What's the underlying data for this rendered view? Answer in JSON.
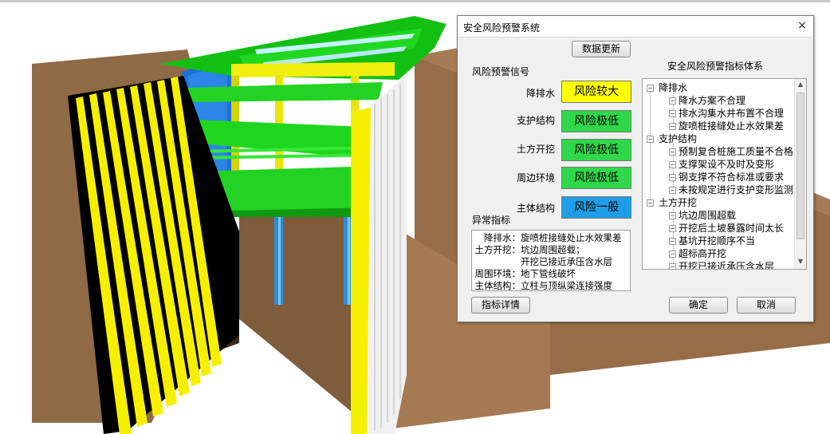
{
  "dialog": {
    "title": "安全风险预警系统",
    "close_symbol": "×",
    "update_button": "数据更新",
    "signal_heading": "风险预警信号",
    "signals": [
      {
        "category": "降排水",
        "level": "风险较大",
        "color": "#ffff00"
      },
      {
        "category": "支护结构",
        "level": "风险极低",
        "color": "#2fd84a"
      },
      {
        "category": "土方开挖",
        "level": "风险极低",
        "color": "#2fd84a"
      },
      {
        "category": "周边环境",
        "level": "风险极低",
        "color": "#2fd84a"
      },
      {
        "category": "主体结构",
        "level": "风险一般",
        "color": "#1e9ee8"
      }
    ],
    "anomaly_heading": "异常指标",
    "anomalies": [
      {
        "category": "降排水：",
        "text": "旋喷桩接缝处止水效果差"
      },
      {
        "category": "土方开挖：",
        "text": "坑边周围超载；"
      },
      {
        "category": "",
        "text": "开挖已接近承压含水层"
      },
      {
        "category": "周围环境：",
        "text": "地下管线破坏"
      },
      {
        "category": "主体结构：",
        "text": "立柱与顶纵梁连接强度"
      }
    ],
    "detail_button": "指标详情",
    "tree_heading": "安全风险预警指标体系",
    "tree": [
      {
        "label": "降排水",
        "children": [
          "降水方案不合理",
          "排水沟集水井布置不合理",
          "旋喷桩接缝处止水效果差"
        ]
      },
      {
        "label": "支护结构",
        "children": [
          "预制复合桩施工质量不合格",
          "支撑架设不及时及变形",
          "钢支撑不符合标准或要求",
          "未按规定进行支护变形监测"
        ]
      },
      {
        "label": "土方开挖",
        "children": [
          "坑边周围超载",
          "开挖后土坡暴露时间太长",
          "基坑开挖顺序不当",
          "超标高开挖",
          "开挖已接近承压含水层"
        ]
      }
    ],
    "ok_button": "确定",
    "cancel_button": "取消"
  }
}
